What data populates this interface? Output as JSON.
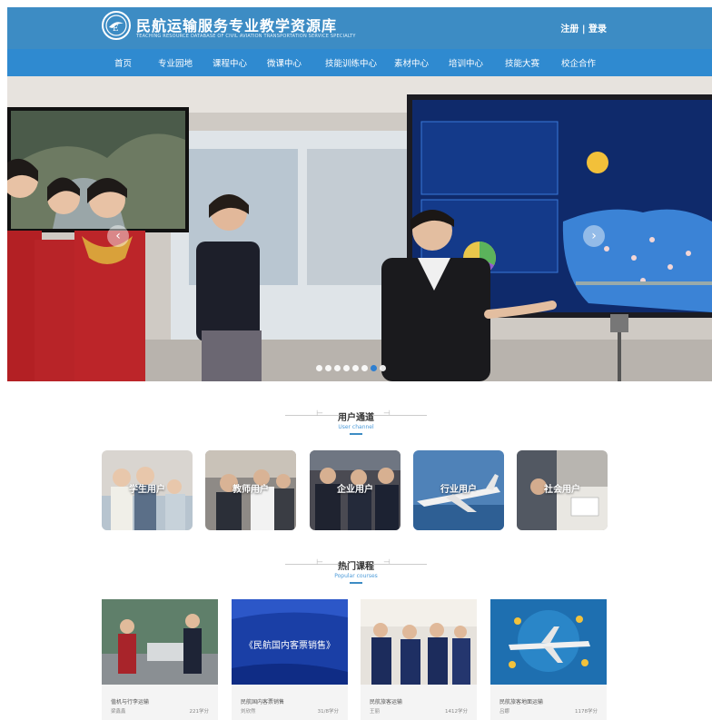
{
  "header": {
    "title": "民航运输服务专业教学资源库",
    "subtitle": "TEACHING RESOURCE DATABASE OF CIVIL AVIATION TRANSPORTATION SERVICE SPECIALTY",
    "auth": "注册 | 登录"
  },
  "nav": [
    "首页",
    "专业园地",
    "课程中心",
    "微课中心",
    "技能训练中心",
    "素材中心",
    "培训中心",
    "技能大赛",
    "校企合作"
  ],
  "hero": {
    "prev_icon": "chevron-left-icon",
    "next_icon": "chevron-right-icon",
    "slide_count": 8,
    "active_slide": 6
  },
  "user_channel": {
    "title": "用户通道",
    "subtitle": "User channel",
    "items": [
      {
        "label": "学生用户"
      },
      {
        "label": "教师用户"
      },
      {
        "label": "企业用户"
      },
      {
        "label": "行业用户"
      },
      {
        "label": "社会用户"
      }
    ]
  },
  "popular_courses": {
    "title": "热门课程",
    "subtitle": "Popular courses",
    "items": [
      {
        "name": "值机与行李运输",
        "teacher": "梁鑫鑫",
        "hours": "221学分"
      },
      {
        "name": "民航国内客票销售",
        "teacher": "刘欣然",
        "hours": "31/8学分",
        "thumb_text": "《民航国内客票销售》"
      },
      {
        "name": "民航旅客运输",
        "teacher": "王丽",
        "hours": "1412学分"
      },
      {
        "name": "民航旅客地面运输",
        "teacher": "吕娜",
        "hours": "1178学分"
      }
    ]
  },
  "colors": {
    "topbar": "#3d8cc4",
    "navbar": "#2f8ad0",
    "accent": "#4b9ad8"
  }
}
